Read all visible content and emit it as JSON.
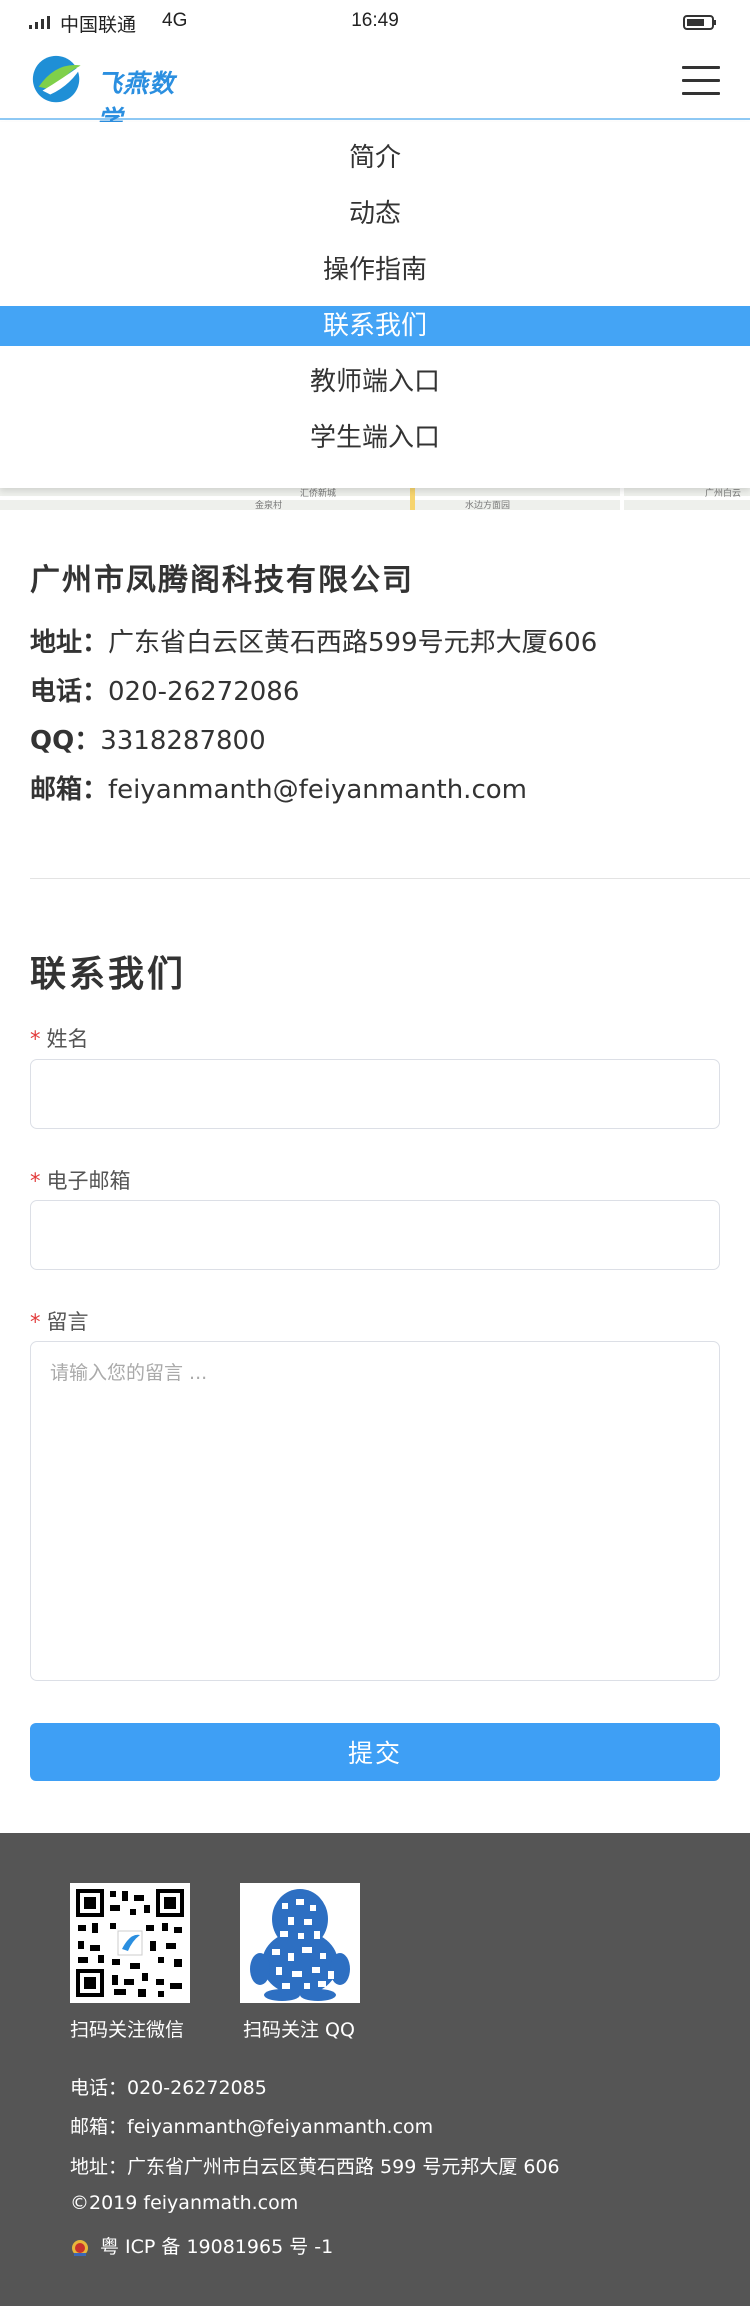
{
  "status_bar": {
    "carrier": "中国联通",
    "network": "4G",
    "time": "16:49"
  },
  "header": {
    "brand": "飞燕数学"
  },
  "nav": {
    "items": [
      {
        "label": "简介",
        "active": false
      },
      {
        "label": "动态",
        "active": false
      },
      {
        "label": "操作指南",
        "active": false
      },
      {
        "label": "联系我们",
        "active": true
      },
      {
        "label": "教师端入口",
        "active": false
      },
      {
        "label": "学生端入口",
        "active": false
      }
    ]
  },
  "map": {
    "labels": [
      "汇侨新城",
      "金泉村",
      "水边方面园",
      "广州白云"
    ]
  },
  "company": {
    "name": "广州市凤腾阁科技有限公司",
    "address_label": "地址：",
    "address": "广东省白云区黄石西路599号元邦大厦606",
    "phone_label": "电话：",
    "phone": "020-26272086",
    "qq_label": "QQ：",
    "qq": "3318287800",
    "email_label": "邮箱：",
    "email": "feiyanmanth@feiyanmanth.com"
  },
  "form": {
    "title": "联系我们",
    "required_mark": "*",
    "name_label": "姓名",
    "email_label": "电子邮箱",
    "message_label": "留言",
    "message_placeholder": "请输入您的留言 ...",
    "submit_label": "提交"
  },
  "footer": {
    "wechat_caption": "扫码关注微信",
    "qq_caption": "扫码关注 QQ",
    "phone": "电话：020-26272085",
    "email": "邮箱：feiyanmanth@feiyanmanth.com",
    "address": "地址：广东省广州市白云区黄石西路 599 号元邦大厦 606",
    "copyright": "©2019 feiyanmath.com",
    "icp": "粤 ICP 备 19081965 号 -1"
  },
  "colors": {
    "accent": "#3e9ff5",
    "nav_active": "#44a4f5",
    "footer_bg": "#555555",
    "required": "#e23a3a"
  },
  "icons": [
    "signal-icon",
    "battery-icon",
    "logo-icon",
    "menu-icon",
    "wechat-qr-code",
    "qq-qr-code",
    "police-badge-icon"
  ]
}
